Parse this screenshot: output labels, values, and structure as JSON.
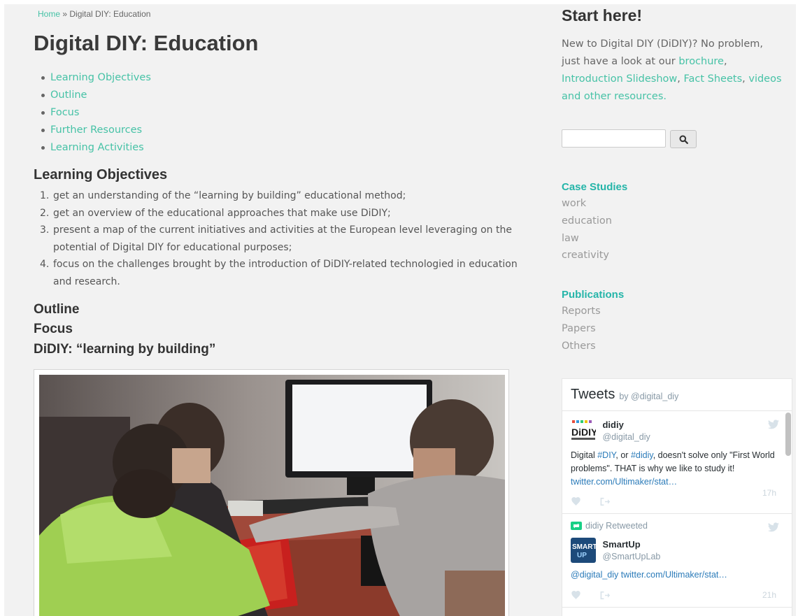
{
  "breadcrumb": {
    "home": "Home",
    "sep": " » ",
    "current": "Digital DIY: Education"
  },
  "page_title": "Digital DIY: Education",
  "toc": [
    "Learning Objectives",
    "Outline",
    "Focus",
    "Further Resources",
    "Learning Activities"
  ],
  "learning_objectives": {
    "heading": "Learning Objectives",
    "items": [
      {
        "num": "1.",
        "text": "get an understanding of the “learning by building” educational method;"
      },
      {
        "num": "2.",
        "text": "get an overview of the educational approaches that make use DiDIY;"
      },
      {
        "num": "3.",
        "text": "present a map of the current initiatives and activities at the European level leveraging on the potential of Digital DIY for educational purposes;"
      },
      {
        "num": "4.",
        "text": "focus on the challenges brought by the introduction of DiDIY-related technologied in education and research."
      }
    ]
  },
  "outline_heading": "Outline",
  "focus_heading": "Focus",
  "didiy_heading": "DiDIY: “learning by building”",
  "sidebar": {
    "start_title": "Start here!",
    "intro_parts": {
      "t1": "New to Digital DIY (DiDIY)? No problem, just have a look at our ",
      "l1": "brochure",
      "t2": ", ",
      "l2": "Introduction Slideshow",
      "t3": ", ",
      "l3": "Fact Sheets",
      "t4": ", ",
      "l4": "videos and other resources."
    },
    "search": {
      "placeholder": "",
      "icon": "search-icon"
    },
    "case_studies": {
      "heading": "Case Studies",
      "items": [
        "work",
        "education",
        "law",
        "creativity"
      ]
    },
    "publications": {
      "heading": "Publications",
      "items": [
        "Reports",
        "Papers",
        "Others"
      ]
    }
  },
  "tweets": {
    "title": "Tweets",
    "by": "by @digital_diy",
    "items": [
      {
        "name": "didiy",
        "handle": "@digital_diy",
        "text_parts": [
          "Digital ",
          "#DIY",
          ", or ",
          "#didiy",
          ", doesn't solve only \"First World problems\". THAT is why we like to study it! ",
          "twitter.com/Ultimaker/stat…"
        ],
        "time": "17h"
      },
      {
        "retweeted_by": "didiy Retweeted",
        "name": "SmartUp",
        "handle": "@SmartUpLab",
        "text_parts": [
          "@digital_diy",
          "  ",
          "twitter.com/Ultimaker/stat…"
        ],
        "time": "21h"
      }
    ]
  },
  "colors": {
    "link": "#46c2a6",
    "heading_teal": "#25b5a9",
    "twitter_blue": "#2b7bb9",
    "page_bg": "#f2f2f2"
  }
}
